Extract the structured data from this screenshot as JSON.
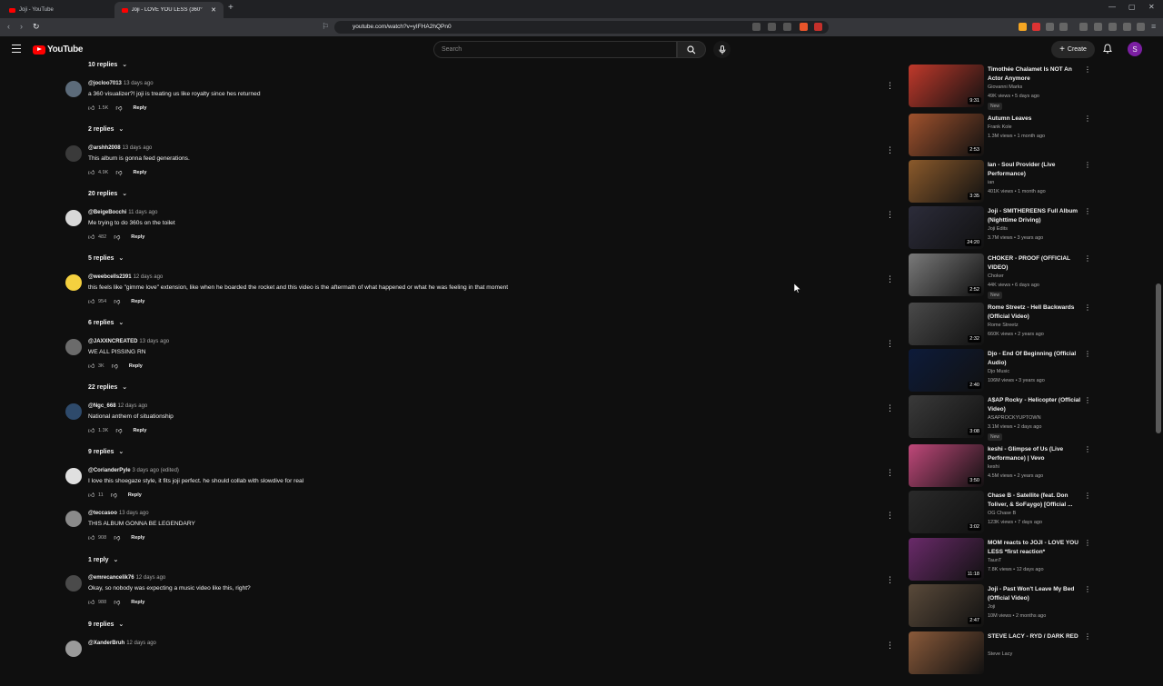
{
  "browser": {
    "tabs": [
      {
        "label": "Joji - YouTube"
      },
      {
        "label": "Joji - LOVE YOU LESS (360° V"
      }
    ],
    "url": "youtube.com/watch?v=yIFHA2hQPn0"
  },
  "header": {
    "logo_text": "YouTube",
    "search_placeholder": "Search",
    "create_label": "Create",
    "avatar_letter": "S"
  },
  "reply_toggles": [
    "10 replies",
    "2 replies",
    "20 replies",
    "5 replies",
    "6 replies",
    "22 replies",
    "9 replies",
    "1 reply",
    "9 replies"
  ],
  "comments": [
    {
      "user": "@jocloo7013",
      "time": "13 days ago",
      "text": "a 360 visualizer?! joji is treating us like royalty since hes returned",
      "likes": "1.5K",
      "reply": "Reply",
      "avatar_color": "#5c6b7a"
    },
    {
      "user": "@arshh2008",
      "time": "13 days ago",
      "text": "This album is gonna feed generations.",
      "likes": "4.9K",
      "reply": "Reply",
      "avatar_color": "#3a3a3a"
    },
    {
      "user": "@BeigeBocchi",
      "time": "11 days ago",
      "text": "Me trying to do 360s on the toilet",
      "likes": "482",
      "reply": "Reply",
      "avatar_color": "#d8d8d8"
    },
    {
      "user": "@weebcells2391",
      "time": "12 days ago",
      "text": "this feels like \"gimme love\" extension, like when he boarded the rocket and this video is the aftermath of what happened or what he was feeling in that moment",
      "likes": "954",
      "reply": "Reply",
      "avatar_color": "#f4d03f"
    },
    {
      "user": "@JAXXNCREATED",
      "time": "13 days ago",
      "text": "WE ALL PISSING RN",
      "likes": "3K",
      "reply": "Reply",
      "avatar_color": "#6b6b6b"
    },
    {
      "user": "@Ngc_668",
      "time": "12 days ago",
      "text": "National anthem of situationship",
      "likes": "1.3K",
      "reply": "Reply",
      "avatar_color": "#2e4a6b"
    },
    {
      "user": "@CorianderPyle",
      "time": "3 days ago (edited)",
      "text": "I love this shoegaze style, it fits joji perfect. he should collab with slowdive for real",
      "likes": "11",
      "reply": "Reply",
      "avatar_color": "#e0e0e0"
    },
    {
      "user": "@teccasoo",
      "time": "13 days ago",
      "text": "THIS ALBUM GONNA BE LEGENDARY",
      "likes": "908",
      "reply": "Reply",
      "avatar_color": "#8a8a8a"
    },
    {
      "user": "@emrecancelik76",
      "time": "12 days ago",
      "text": "Okay, so nobody was expecting a music video like this, right?",
      "likes": "988",
      "reply": "Reply",
      "avatar_color": "#4a4a4a"
    },
    {
      "user": "@XanderBruh",
      "time": "12 days ago",
      "text": "",
      "likes": "",
      "reply": "",
      "avatar_color": "#9a9a9a"
    }
  ],
  "recommendations": [
    {
      "title": "Timothée Chalamet Is NOT An Actor Anymore",
      "channel": "Giovanni Marks",
      "meta": "49K views • 5 days ago",
      "badge": "New",
      "duration": "9:31",
      "thumb_color": "#c0392b"
    },
    {
      "title": "Autumn Leaves",
      "channel": "Frank Kole",
      "meta": "1.3M views • 1 month ago",
      "badge": "",
      "duration": "2:53",
      "thumb_color": "#a0522d"
    },
    {
      "title": "Ian - Soul Provider (Live Performance)",
      "channel": "ian",
      "meta": "401K views • 1 month ago",
      "badge": "",
      "duration": "3:35",
      "thumb_color": "#8b5a2b"
    },
    {
      "title": "Joji - SMITHEREENS Full Album (Nighttime Driving)",
      "channel": "Joji Edits",
      "meta": "3.7M views • 3 years ago",
      "badge": "",
      "duration": "24:20",
      "thumb_color": "#2c2c3a"
    },
    {
      "title": "CHOKER - PROOF (OFFICIAL VIDEO)",
      "channel": "Choker",
      "meta": "44K views • 6 days ago",
      "badge": "New",
      "duration": "2:52",
      "thumb_color": "#7a7a7a"
    },
    {
      "title": "Rome Streetz - Hell Backwards (Official Video)",
      "channel": "Rome Streetz",
      "meta": "660K views • 2 years ago",
      "badge": "",
      "duration": "2:32",
      "thumb_color": "#4a4a4a"
    },
    {
      "title": "Djo - End Of Beginning (Official Audio)",
      "channel": "Djo Music",
      "meta": "106M views • 3 years ago",
      "badge": "",
      "duration": "2:40",
      "thumb_color": "#0d1b3a"
    },
    {
      "title": "A$AP Rocky - Helicopter (Official Video)",
      "channel": "ASAPROCKYUPTOWN",
      "meta": "3.1M views • 2 days ago",
      "badge": "New",
      "duration": "3:08",
      "thumb_color": "#3a3a3a"
    },
    {
      "title": "keshi - Glimpse of Us (Live Performance) | Vevo",
      "channel": "keshi",
      "meta": "4.5M views • 2 years ago",
      "badge": "",
      "duration": "3:50",
      "thumb_color": "#c0487a"
    },
    {
      "title": "Chase B - Satellite (feat. Don Toliver, & SoFaygo) [Official ...",
      "channel": "OG Chase B",
      "meta": "123K views • 7 days ago",
      "badge": "",
      "duration": "3:02",
      "thumb_color": "#2a2a2a"
    },
    {
      "title": "MOM reacts to JOJI - LOVE YOU LESS *first reaction*",
      "channel": "TaunT",
      "meta": "7.8K views • 12 days ago",
      "badge": "",
      "duration": "11:18",
      "thumb_color": "#6a2a6a"
    },
    {
      "title": "Joji - Past Won't Leave My Bed (Official Video)",
      "channel": "Joji",
      "meta": "10M views • 2 months ago",
      "badge": "",
      "duration": "2:47",
      "thumb_color": "#5a4a3a"
    },
    {
      "title": "STEVE LACY - RYD / DARK RED",
      "channel": "Steve Lacy",
      "meta": "",
      "badge": "",
      "duration": "",
      "thumb_color": "#8a5a3a"
    }
  ]
}
